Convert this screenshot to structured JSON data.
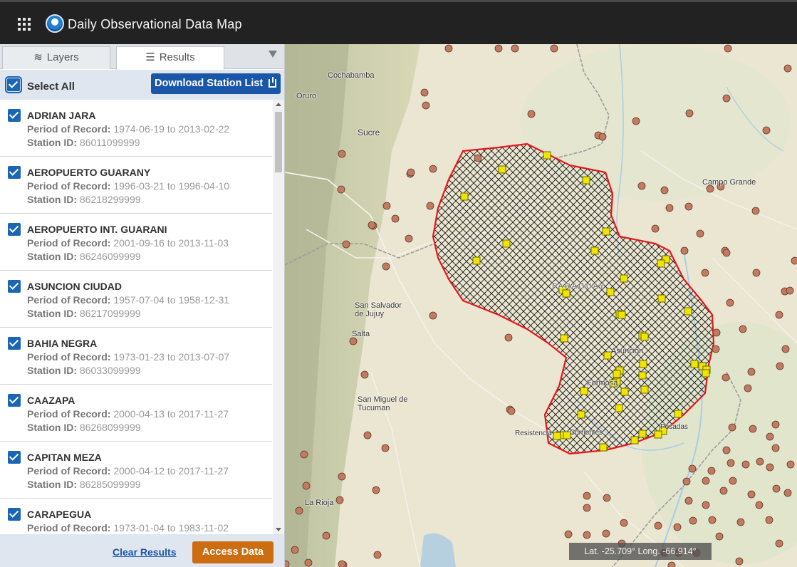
{
  "header": {
    "title": "Daily Observational Data Map",
    "apps_icon": "grid-icon",
    "logo": "noaa-logo"
  },
  "tabs": [
    {
      "label": "Layers",
      "icon": "layers-icon"
    },
    {
      "label": "Results",
      "icon": "list-icon"
    }
  ],
  "select_all": {
    "label": "Select All",
    "checked": true
  },
  "download_button": "Download Station List",
  "labels": {
    "period": "Period of Record:",
    "station": "Station ID:",
    "to": "to"
  },
  "stations": [
    {
      "name": "ADRIAN JARA",
      "start": "1974-06-19",
      "end": "2013-02-22",
      "id": "86011099999"
    },
    {
      "name": "AEROPUERTO GUARANY",
      "start": "1996-03-21",
      "end": "1996-04-10",
      "id": "86218299999"
    },
    {
      "name": "AEROPUERTO INT. GUARANI",
      "start": "2001-09-16",
      "end": "2013-11-03",
      "id": "86246099999"
    },
    {
      "name": "ASUNCION CIUDAD",
      "start": "1957-07-04",
      "end": "1958-12-31",
      "id": "86217099999"
    },
    {
      "name": "BAHIA NEGRA",
      "start": "1973-01-23",
      "end": "2013-07-07",
      "id": "86033099999"
    },
    {
      "name": "CAAZAPA",
      "start": "2000-04-13",
      "end": "2017-11-27",
      "id": "86268099999"
    },
    {
      "name": "CAPITAN MEZA",
      "start": "2000-04-12",
      "end": "2017-11-27",
      "id": "86285099999"
    },
    {
      "name": "CARAPEGUA",
      "start": "1973-01-04",
      "end": "1983-11-02",
      "id": ""
    }
  ],
  "footer": {
    "clear_label": "Clear Results",
    "access_label": "Access Data"
  },
  "map": {
    "places": [
      "Cochabamba",
      "Oruro",
      "Sucre",
      "Campo Grande",
      "PARAGUAY",
      "San Salvador de Jujuy",
      "Salta",
      "Asuncion",
      "Formosa",
      "San Miguel de Tucuman",
      "Resistencia",
      "Corrientes",
      "Posadas",
      "La Rioja"
    ],
    "coordinates": "Lat. -25.709°  Long. -66.914°",
    "colors": {
      "selection_outline": "#e8161c",
      "station_selected": "#f1e400",
      "station_other": "#c47a5e"
    }
  }
}
